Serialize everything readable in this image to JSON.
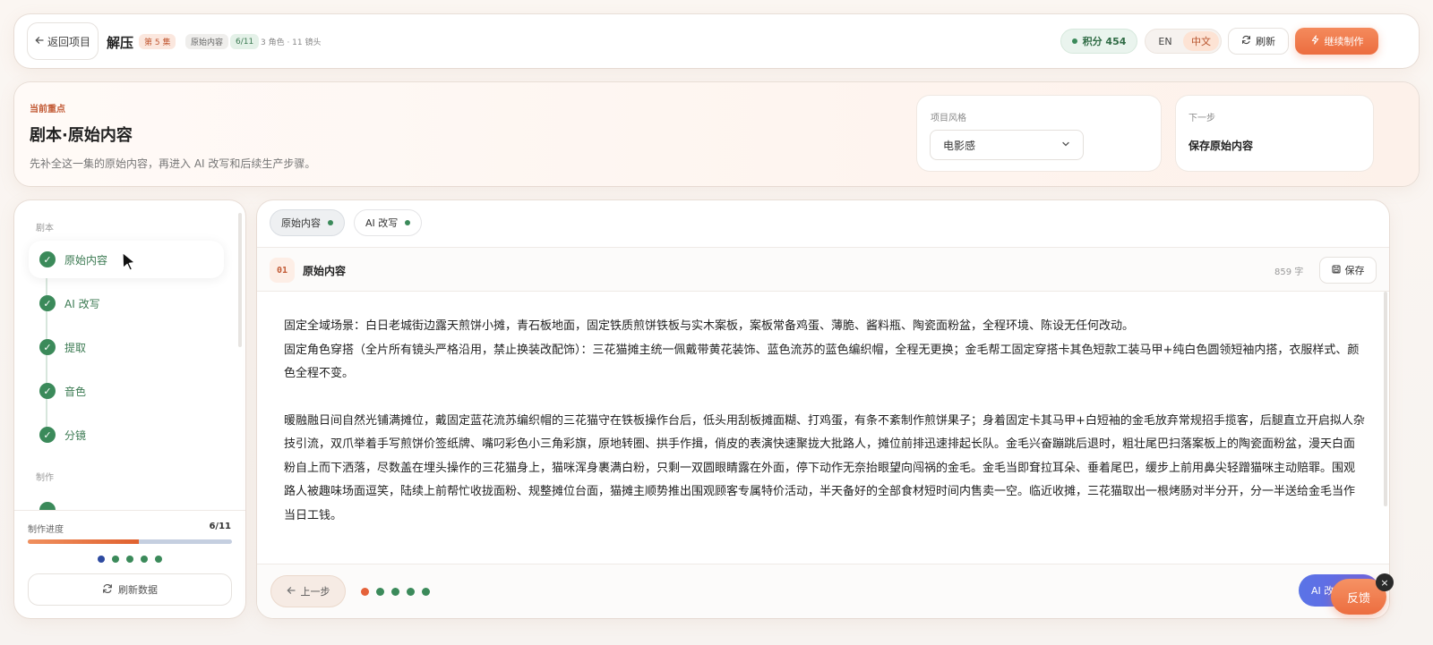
{
  "header": {
    "back_label": "返回项目",
    "project_title": "解压",
    "episode_badge": "第 5 集",
    "stage_badge": "原始内容",
    "progress_badge": "6/11",
    "meta": "3 角色 · 11 镜头",
    "points": "积分 454",
    "lang_en": "EN",
    "lang_zh": "中文",
    "active_lang": "zh",
    "refresh_label": "刷新",
    "continue_label": "继续制作"
  },
  "focus": {
    "kicker": "当前重点",
    "title": "剧本·原始内容",
    "description": "先补全这一集的原始内容，再进入 AI 改写和后续生产步骤。",
    "style_label": "项目风格",
    "style_value": "电影感",
    "next_label": "下一步",
    "next_value": "保存原始内容"
  },
  "sidebar": {
    "group_script": "剧本",
    "group_produce": "制作",
    "steps": [
      {
        "label": "原始内容",
        "active": true
      },
      {
        "label": "AI 改写",
        "active": false
      },
      {
        "label": "提取",
        "active": false
      },
      {
        "label": "音色",
        "active": false
      },
      {
        "label": "分镜",
        "active": false
      }
    ],
    "progress_label": "制作进度",
    "progress_count": "6/11",
    "progress_fraction": 0.545,
    "refresh_label": "刷新数据"
  },
  "main": {
    "tabs": [
      {
        "label": "原始内容",
        "active": true
      },
      {
        "label": "AI 改写",
        "active": false
      }
    ],
    "section_number": "01",
    "section_title": "原始内容",
    "word_count": "859 字",
    "save_label": "保存",
    "paragraphs": [
      "固定全域场景：白日老城街边露天煎饼小摊，青石板地面，固定铁质煎饼铁板与实木案板，案板常备鸡蛋、薄脆、酱料瓶、陶瓷面粉盆，全程环境、陈设无任何改动。",
      "固定角色穿搭（全片所有镜头严格沿用，禁止换装改配饰）：三花猫摊主统一佩戴带黄花装饰、蓝色流苏的蓝色编织帽，全程无更换；金毛帮工固定穿搭卡其色短款工装马甲+纯白色圆领短袖内搭，衣服样式、颜色全程不变。",
      "暖融融日间自然光铺满摊位，戴固定蓝花流苏编织帽的三花猫守在铁板操作台后，低头用刮板摊面糊、打鸡蛋，有条不紊制作煎饼果子；身着固定卡其马甲+白短袖的金毛放弃常规招手揽客，后腿直立开启拟人杂技引流，双爪举着手写煎饼价签纸牌、嘴叼彩色小三角彩旗，原地转圈、拱手作揖，俏皮的表演快速聚拢大批路人，摊位前排迅速排起长队。金毛兴奋蹦跳后退时，粗壮尾巴扫落案板上的陶瓷面粉盆，漫天白面粉自上而下洒落，尽数盖在埋头操作的三花猫身上，猫咪浑身裹满白粉，只剩一双圆眼睛露在外面，停下动作无奈抬眼望向闯祸的金毛。金毛当即耷拉耳朵、垂着尾巴，缓步上前用鼻尖轻蹭猫咪主动赔罪。围观路人被趣味场面逗笑，陆续上前帮忙收拢面粉、规整摊位台面，猫摊主顺势推出围观顾客专属特价活动，半天备好的全部食材短时间内售卖一空。临近收摊，三花猫取出一根烤肠对半分开，分一半送给金毛当作当日工钱。"
    ],
    "prev_label": "上一步"
  },
  "floating": {
    "ai_label": "AI 改",
    "feedback_label": "反馈",
    "close_symbol": "×"
  }
}
